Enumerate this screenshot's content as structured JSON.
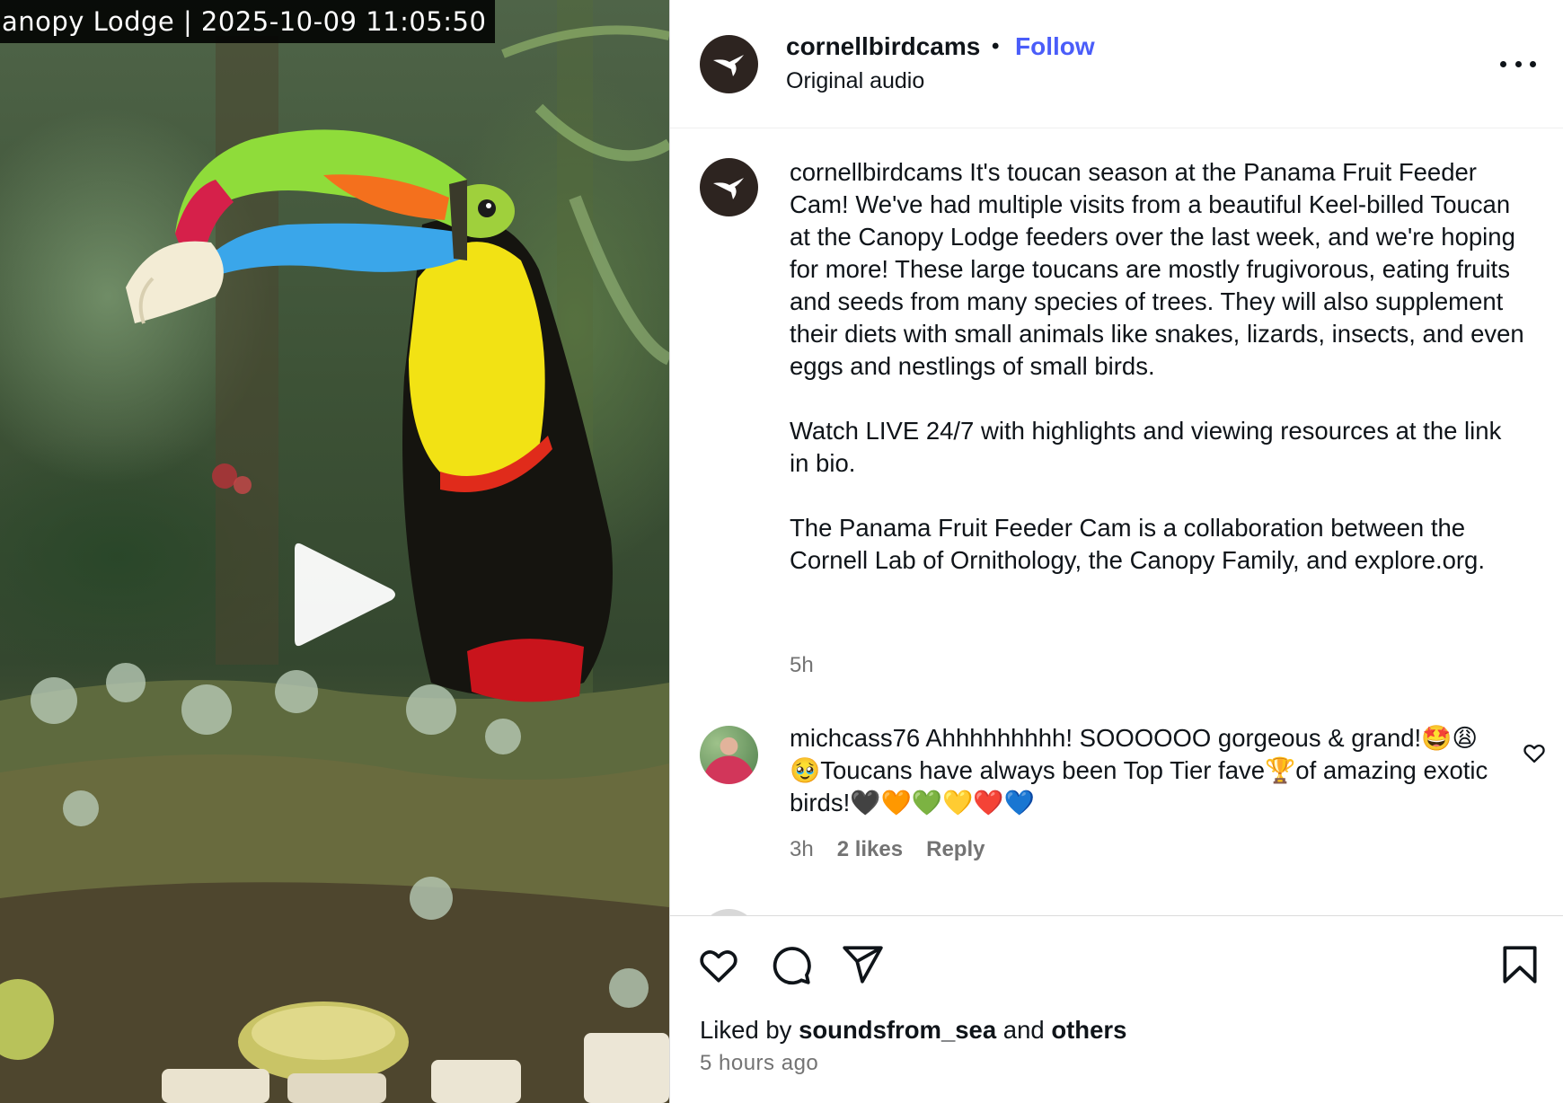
{
  "video": {
    "overlay_text": "anopy Lodge | 2025-10-09  11:05:50",
    "play_icon": "play-icon"
  },
  "header": {
    "username": "cornellbirdcams",
    "separator": "•",
    "follow_label": "Follow",
    "audio_label": "Original audio",
    "avatar_icon": "hummingbird-logo-icon",
    "more_icon": "more-options-icon"
  },
  "caption": {
    "username": "cornellbirdcams",
    "paragraph_1": "It's toucan season at the Panama Fruit Feeder Cam! We've had multiple visits from a beautiful Keel-billed Toucan at the Canopy Lodge feeders over the last week, and we're hoping for more! These large toucans are mostly frugivorous, eating fruits and seeds from many species of trees. They will also supplement their diets with small animals like snakes, lizards, insects, and even eggs and nestlings of small birds.",
    "paragraph_2": "Watch LIVE 24/7 with highlights and viewing resources at the link in bio.",
    "paragraph_3": "The Panama Fruit Feeder Cam is a collaboration between the Cornell Lab of Ornithology, the Canopy Family, and explore.org.",
    "time": "5h"
  },
  "comment": {
    "username": "michcass76",
    "text": "Ahhhhhhhhh! SOOOOOO gorgeous & grand!🤩😩🥹Toucans have always been Top Tier fave🏆of amazing exotic birds!🖤🧡💚💛❤️💙",
    "time": "3h",
    "likes": "2 likes",
    "reply_label": "Reply",
    "like_icon": "heart-outline-icon"
  },
  "actions": {
    "icons": [
      "heart-icon",
      "comment-icon",
      "share-icon",
      "bookmark-icon"
    ],
    "liked_by_prefix": "Liked by",
    "liked_by_user": "soundsfrom_sea",
    "liked_by_and": "and",
    "liked_by_others": "others",
    "posted_time": "5 hours ago"
  },
  "colors": {
    "follow_blue": "#4a5df9",
    "secondary_text": "#737373",
    "primary_text": "#0f1419"
  }
}
